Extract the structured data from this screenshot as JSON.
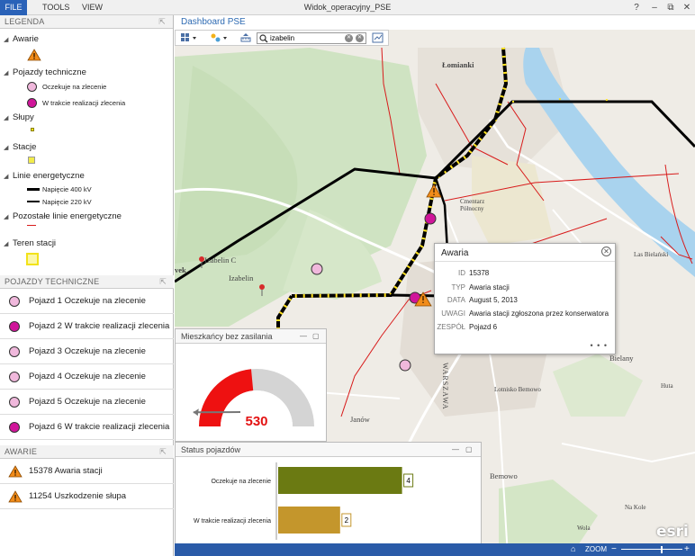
{
  "window": {
    "title": "Widok_operacyjny_PSE",
    "menu": [
      "FILE",
      "TOOLS",
      "VIEW"
    ],
    "controls": [
      "?",
      "–",
      "⧉",
      "✕"
    ]
  },
  "legend": {
    "header": "LEGENDA",
    "groups": [
      {
        "label": "Awarie"
      },
      {
        "label": "Pojazdy techniczne",
        "items": [
          "Oczekuje na zlecenie",
          "W trakcie realizacji zlecenia"
        ]
      },
      {
        "label": "Słupy"
      },
      {
        "label": "Stacje"
      },
      {
        "label": "Linie energetyczne",
        "items": [
          "Napięcie 400 kV",
          "Napięcie 220 kV"
        ]
      },
      {
        "label": "Pozostałe linie energetyczne"
      },
      {
        "label": "Teren stacji"
      }
    ]
  },
  "vehicles": {
    "header": "POJAZDY TECHNICZNE",
    "items": [
      {
        "label": "Pojazd 1 Oczekuje na zlecenie",
        "color": "#f0b8dc"
      },
      {
        "label": "Pojazd 2 W trakcie realizacji zlecenia",
        "color": "#d0159a"
      },
      {
        "label": "Pojazd 3 Oczekuje na zlecenie",
        "color": "#f0b8dc"
      },
      {
        "label": "Pojazd 4 Oczekuje na zlecenie",
        "color": "#f0b8dc"
      },
      {
        "label": "Pojazd 5 Oczekuje na zlecenie",
        "color": "#f0b8dc"
      },
      {
        "label": "Pojazd 6 W trakcie realizacji zlecenia",
        "color": "#d0159a"
      }
    ]
  },
  "alerts": {
    "header": "AWARIE",
    "items": [
      {
        "label": "15378 Awaria stacji"
      },
      {
        "label": "11254 Uszkodzenie słupa"
      }
    ]
  },
  "map": {
    "title": "Dashboard PSE",
    "search_value": "izabelin",
    "labels": [
      "Łomianki",
      "Izabelin C",
      "Izabelin",
      "Cmentarz Północny",
      "WARSZAWA",
      "Janów",
      "Bemowo",
      "Lotnisko Bemowo",
      "Bielany",
      "Las Bielański",
      "Huta",
      "vek",
      "Na Kole",
      "Wola"
    ],
    "zoom_label": "ZOOM",
    "brand": "esri"
  },
  "popup": {
    "title": "Awaria",
    "fields": [
      {
        "key": "ID",
        "value": "15378"
      },
      {
        "key": "TYP",
        "value": "Awaria stacji"
      },
      {
        "key": "DATA",
        "value": "August 5, 2013"
      },
      {
        "key": "UWAGI",
        "value": "Awaria stacji zgłoszona przez konserwatora"
      },
      {
        "key": "ZESPÓŁ",
        "value": "Pojazd 6"
      }
    ],
    "more": "• • •"
  },
  "gauge": {
    "title": "Mieszkańcy bez zasilania",
    "value": "530",
    "fill_fraction": 0.47,
    "color": "#ee1111"
  },
  "status_chart": {
    "title": "Status pojazdów",
    "chart_data": {
      "type": "bar",
      "orientation": "horizontal",
      "categories": [
        "Oczekuje na zlecenie",
        "W trakcie realizacji zlecenia"
      ],
      "values": [
        4,
        2
      ],
      "colors": [
        "#6b7a12",
        "#c4962c"
      ]
    }
  }
}
